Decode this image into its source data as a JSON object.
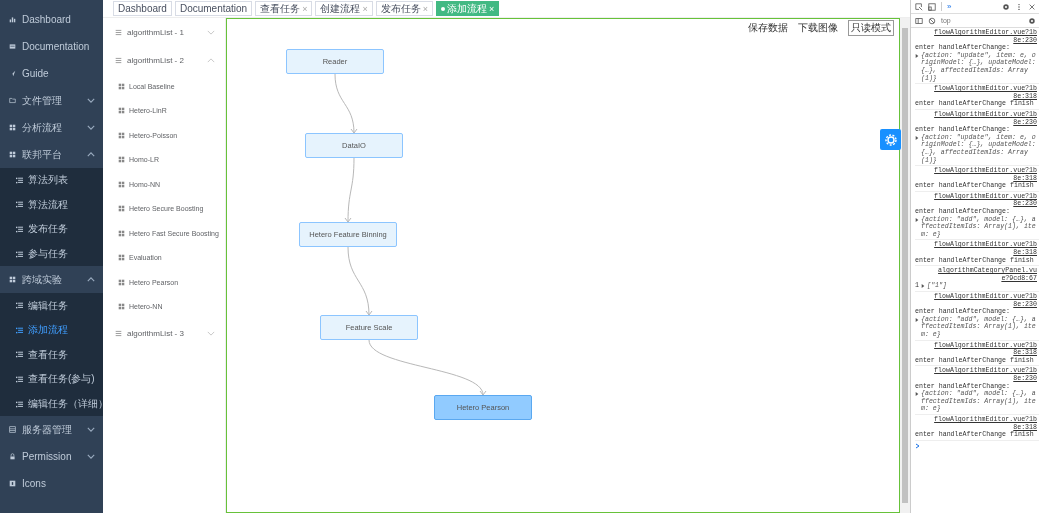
{
  "sidebar": {
    "items": [
      {
        "label": "Dashboard"
      },
      {
        "label": "Documentation"
      },
      {
        "label": "Guide"
      },
      {
        "label": "文件管理",
        "expanded": false
      },
      {
        "label": "分析流程",
        "expanded": false
      },
      {
        "label": "联邦平台",
        "expanded": true,
        "children": [
          {
            "label": "算法列表",
            "selected": false
          },
          {
            "label": "算法流程",
            "selected": false
          },
          {
            "label": "发布任务",
            "selected": false
          },
          {
            "label": "参与任务",
            "selected": false
          }
        ]
      },
      {
        "label": "跨域实验",
        "expanded": true,
        "children": [
          {
            "label": "编辑任务",
            "selected": false
          },
          {
            "label": "添加流程",
            "selected": true
          },
          {
            "label": "查看任务",
            "selected": false
          },
          {
            "label": "查看任务(参与)",
            "selected": false
          },
          {
            "label": "编辑任务（详细）",
            "selected": false
          }
        ]
      },
      {
        "label": "服务器管理",
        "expanded": false
      },
      {
        "label": "Permission",
        "expanded": false
      },
      {
        "label": "Icons"
      }
    ]
  },
  "tags": [
    {
      "label": "Dashboard",
      "selected": false
    },
    {
      "label": "Documentation",
      "selected": false
    },
    {
      "label": "查看任务",
      "selected": false,
      "close": "×"
    },
    {
      "label": "创建流程",
      "selected": false,
      "close": "×"
    },
    {
      "label": "发布任务",
      "selected": false,
      "close": "×"
    },
    {
      "label": "添加流程",
      "selected": true,
      "close": "×"
    }
  ],
  "algorithm_panel": {
    "groups": [
      {
        "label": "algorithmList - 1",
        "expanded": false
      },
      {
        "label": "algorithmList - 2",
        "expanded": true,
        "items": [
          "Local Baseline",
          "Hetero-LinR",
          "Hetero-Poisson",
          "Homo-LR",
          "Homo-NN",
          "Hetero Secure Boosting",
          "Hetero Fast Secure Boosting",
          "Evaluation",
          "Hetero Pearson",
          "Hetero-NN"
        ]
      },
      {
        "label": "algorithmList - 3",
        "expanded": false
      }
    ]
  },
  "canvas": {
    "toolbar": [
      {
        "label": "保存数据",
        "kind": "link"
      },
      {
        "label": "下载图像",
        "kind": "link"
      },
      {
        "label": "只读模式",
        "kind": "button"
      }
    ],
    "nodes": [
      {
        "label": "Reader",
        "selected": false
      },
      {
        "label": "DataIO",
        "selected": false
      },
      {
        "label": "Hetero Feature Binning",
        "selected": false
      },
      {
        "label": "Feature Scale",
        "selected": false
      },
      {
        "label": "Hetero Pearson",
        "selected": true
      }
    ]
  },
  "devtools": {
    "more_tabs": "»",
    "context": "top",
    "console": [
      {
        "source": "flowAlgorithmEditor.vue?1b",
        "location": "8e:230",
        "message": "enter handleAfterChange:",
        "kind": "object",
        "detail": "{action: \"update\", item: e, originModel: {…}, updateModel: {…}, affectedItemIds: Array(1)}"
      },
      {
        "source": "flowAlgorithmEditor.vue?1b",
        "location": "8e:318",
        "message": "enter handleAfterChange finish",
        "kind": "text"
      },
      {
        "source": "flowAlgorithmEditor.vue?1b",
        "location": "8e:230",
        "message": "enter handleAfterChange:",
        "kind": "object",
        "detail": "{action: \"update\", item: e, originModel: {…}, updateModel: {…}, affectedItemIds: Array(1)}"
      },
      {
        "source": "flowAlgorithmEditor.vue?1b",
        "location": "8e:318",
        "message": "enter handleAfterChange finish",
        "kind": "text"
      },
      {
        "source": "flowAlgorithmEditor.vue?1b",
        "location": "8e:230",
        "message": "enter handleAfterChange:",
        "kind": "object",
        "detail": "{action: \"add\", model: {…}, affectedItemIds: Array(1), item: e}"
      },
      {
        "source": "flowAlgorithmEditor.vue?1b",
        "location": "8e:318",
        "message": "enter handleAfterChange finish",
        "kind": "text"
      },
      {
        "source": "algorithmCategoryPanel.vu",
        "location": "e?9cd8:67",
        "message": "1",
        "kind": "inline",
        "detail": "[\"1\"]"
      },
      {
        "source": "flowAlgorithmEditor.vue?1b",
        "location": "8e:230",
        "message": "enter handleAfterChange:",
        "kind": "object",
        "detail": "{action: \"add\", model: {…}, affectedItemIds: Array(1), item: e}"
      },
      {
        "source": "flowAlgorithmEditor.vue?1b",
        "location": "8e:318",
        "message": "enter handleAfterChange finish",
        "kind": "text"
      },
      {
        "source": "flowAlgorithmEditor.vue?1b",
        "location": "8e:230",
        "message": "enter handleAfterChange:",
        "kind": "object",
        "detail": "{action: \"add\", model: {…}, affectedItemIds: Array(1), item: e}"
      },
      {
        "source": "flowAlgorithmEditor.vue?1b",
        "location": "8e:318",
        "message": "enter handleAfterChange finish",
        "kind": "text"
      }
    ]
  }
}
